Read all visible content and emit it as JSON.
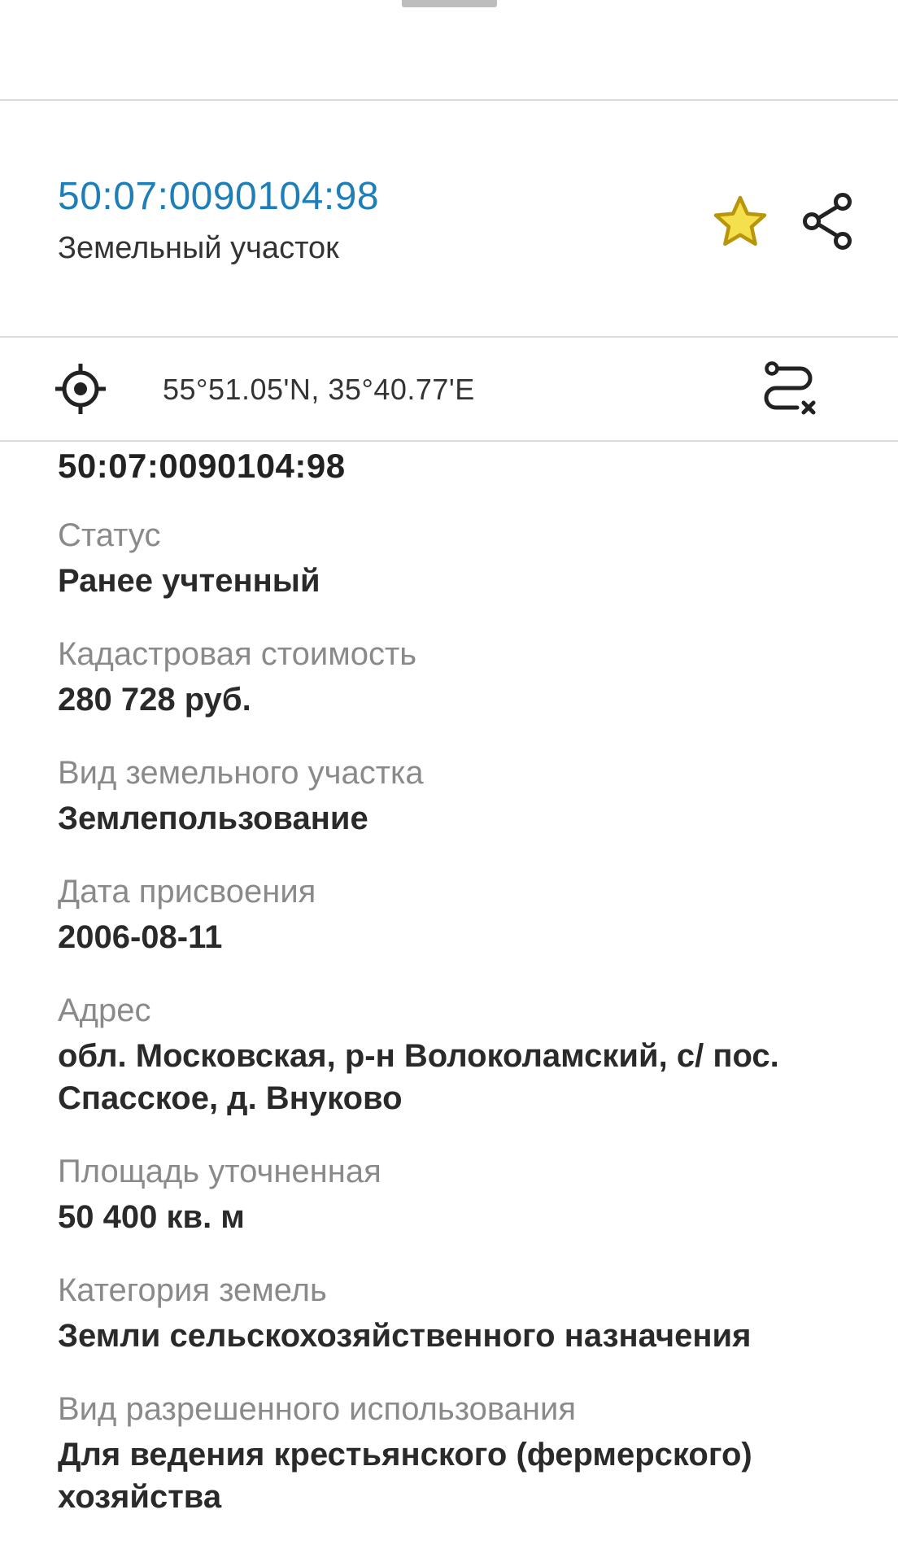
{
  "header": {
    "parcel_id": "50:07:0090104:98",
    "parcel_type": "Земельный участок"
  },
  "icons": {
    "favorite": "star-icon",
    "share": "share-icon",
    "locate": "crosshair-icon",
    "route": "route-clear-icon"
  },
  "colors": {
    "accent_link": "#1e7fb8",
    "star_fill": "#f4e04d",
    "star_stroke": "#b8950a",
    "label": "#8a8a8a",
    "value": "#2a2a2a",
    "divider": "#d9d9d9"
  },
  "coords": {
    "text": "55°51.05'N, 35°40.77'E"
  },
  "details": {
    "cadastral_number": "50:07:0090104:98",
    "fields": [
      {
        "label": "Статус",
        "value": "Ранее учтенный"
      },
      {
        "label": "Кадастровая стоимость",
        "value": "280 728 руб."
      },
      {
        "label": "Вид земельного участка",
        "value": "Землепользование"
      },
      {
        "label": "Дата присвоения",
        "value": "2006-08-11"
      },
      {
        "label": "Адрес",
        "value": "обл. Московская, р-н Волоколамский, с/ пос. Спасское, д. Внуково"
      },
      {
        "label": "Площадь уточненная",
        "value": "50 400 кв. м"
      },
      {
        "label": "Категория земель",
        "value": "Земли сельскохозяйственного назначения"
      },
      {
        "label": "Вид разрешенного использования",
        "value": "Для ведения крестьянского (фермерского) хозяйства"
      }
    ]
  }
}
